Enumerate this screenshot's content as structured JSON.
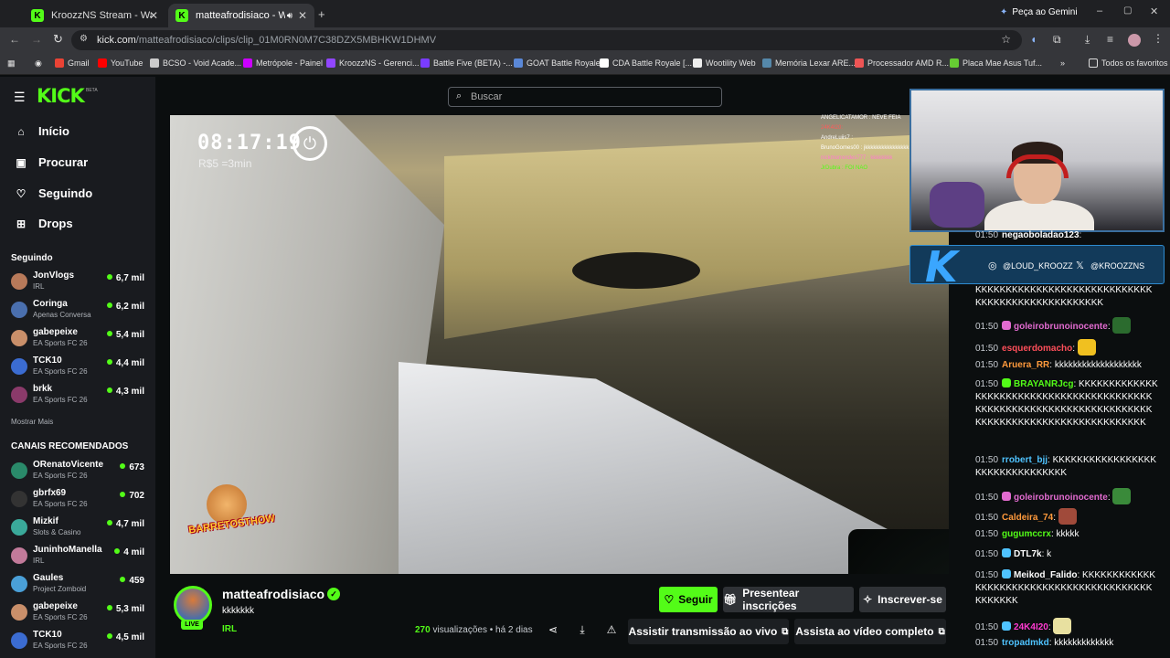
{
  "browser": {
    "tabs": [
      {
        "title": "KroozzNS Stream - Watch Live o",
        "favicon": "kick-icon"
      },
      {
        "title": "matteafrodisiaco - Watch cl",
        "favicon": "kick-icon"
      }
    ],
    "gemini_label": "Peça ao Gemini",
    "url_host": "kick.com",
    "url_path": "/matteafrodisiaco/clips/clip_01M0RN0M7C38DZX5MBHKW1DHMV",
    "bookmarks": [
      "Gmail",
      "YouTube",
      "BCSO - Void Acade...",
      "Metrópole - Painel",
      "KroozzNS - Gerenci...",
      "Battle Five (BETA) -...",
      "GOAT Battle Royale",
      "CDA Battle Royale [...",
      "Wootility Web",
      "Memória Lexar ARE...",
      "Processador AMD R...",
      "Placa Mae Asus Tuf..."
    ],
    "all_bookmarks": "Todos os favoritos"
  },
  "app": {
    "logo": "KICK",
    "logo_sup": "BETA",
    "search_placeholder": "Buscar",
    "nav": [
      {
        "label": "Início",
        "icon": "home-icon"
      },
      {
        "label": "Procurar",
        "icon": "browse-icon"
      },
      {
        "label": "Seguindo",
        "icon": "heart-icon"
      },
      {
        "label": "Drops",
        "icon": "drops-icon"
      }
    ],
    "following_title": "Seguindo",
    "following": [
      {
        "name": "JonVlogs",
        "category": "IRL",
        "viewers": "6,7 mil"
      },
      {
        "name": "Coringa",
        "category": "Apenas Conversa",
        "viewers": "6,2 mil"
      },
      {
        "name": "gabepeixe",
        "category": "EA Sports FC 26",
        "viewers": "5,4 mil"
      },
      {
        "name": "TCK10",
        "category": "EA Sports FC 26",
        "viewers": "4,4 mil"
      },
      {
        "name": "brkk",
        "category": "EA Sports FC 26",
        "viewers": "4,3 mil"
      }
    ],
    "show_more": "Mostrar Mais",
    "recommended_title": "CANAIS RECOMENDADOS",
    "recommended": [
      {
        "name": "ORenatoVicente",
        "category": "EA Sports FC 26",
        "viewers": "673"
      },
      {
        "name": "gbrfx69",
        "category": "EA Sports FC 26",
        "viewers": "702"
      },
      {
        "name": "Mizkif",
        "category": "Slots & Casino",
        "viewers": "4,7 mil"
      },
      {
        "name": "JuninhoManella",
        "category": "IRL",
        "viewers": "4 mil"
      },
      {
        "name": "Gaules",
        "category": "Project Zomboid",
        "viewers": "459"
      },
      {
        "name": "gabepeixe",
        "category": "EA Sports FC 26",
        "viewers": "5,3 mil"
      },
      {
        "name": "TCK10",
        "category": "EA Sports FC 26",
        "viewers": "4,5 mil"
      }
    ]
  },
  "video": {
    "clock": "08:17:19",
    "rate": "R$5 =3min",
    "overlay_chat": [
      "ANGELICATAMOR : NEVE FEIA",
      "24K4I20:",
      "AndreLuiis7 :",
      "BrunoGomes00 : jkkkkkkkkkkkkkkkk",
      "nickmorrendes777 : kkkkkkkk",
      "JrDubra : FOI NAO"
    ],
    "sponsor_logo": "BARRETOSTHOW"
  },
  "stream_overlay": {
    "instagram": "@LOUD_KROOZZ",
    "x": "@KROOZZNS"
  },
  "chat": [
    {
      "time": "01:50",
      "user": "negaoboladao123",
      "color": "#ffffff",
      "text": "",
      "top": 0
    },
    {
      "time": "",
      "user": "",
      "color": "#ffffff",
      "text": "KKKKKKKKKKKKKKKKKKKKKKKKKKKKKKKKKKKKKKKKKKKKKKKKKK"
    },
    {
      "time": "01:50",
      "user": "goleirobrunoinocente",
      "color": "#e26bd0",
      "text": ""
    },
    {
      "time": "01:50",
      "user": "esquerdomacho",
      "color": "#ff4f5a",
      "text": ""
    },
    {
      "time": "01:50",
      "user": "Aruera_RR",
      "color": "#ff9a3c",
      "text": "kkkkkkkkkkkkkkkkkkk"
    },
    {
      "time": "01:50",
      "user": "BRAYANRJcg",
      "color": "#53fc18",
      "text": "KKKKKKKKKKKKKKKKKKKKKKKKKKKKKKKKKKKKKKKKKKKKKKKKKKKKKKKKKKKKKKKKKKKKKKKKKKKKKKKKKKKKKKKKKKKKKKKKKKK"
    },
    {
      "time": "01:50",
      "user": "rrobert_bjj",
      "color": "#4fc3ff",
      "text": "KKKKKKKKKKKKKKKKKKKKKKKKKKKKKKKK"
    },
    {
      "time": "01:50",
      "user": "goleirobrunoinocente",
      "color": "#e26bd0",
      "text": ""
    },
    {
      "time": "01:50",
      "user": "Caldeira_74",
      "color": "#ff9a3c",
      "text": ""
    },
    {
      "time": "01:50",
      "user": "gugumccrx",
      "color": "#53fc18",
      "text": "kkkkk"
    },
    {
      "time": "01:50",
      "user": "DTL7k",
      "color": "#ffffff",
      "text": "k"
    },
    {
      "time": "01:50",
      "user": "Meikod_Falido",
      "color": "#ffffff",
      "text": "KKKKKKKKKKKKKKKKKKKKKKKKKKKKKKKKKKKKKKKKKKKKKKKK"
    },
    {
      "time": "01:50",
      "user": "24K4I20",
      "color": "#ff3ad0",
      "text": ""
    },
    {
      "time": "01:50",
      "user": "tropadmkd",
      "color": "#4fc3ff",
      "text": "kkkkkkkkkkkkk"
    }
  ],
  "clip": {
    "channel": "matteafrodisiaco",
    "title": "kkkkkkk",
    "category": "IRL",
    "live_badge": "LIVE",
    "views_count": "270",
    "views_label": "visualizações",
    "age": "há 2 dias",
    "follow_label": "Seguir",
    "gift_label": "Presentear inscrições",
    "subscribe_label": "Inscrever-se",
    "watch_live_label": "Assistir transmissão ao vivo",
    "watch_full_label": "Assista ao vídeo completo"
  },
  "colors": {
    "accent": "#53fc18",
    "bg": "#0b0e0f",
    "sidebar": "#191b1f"
  }
}
